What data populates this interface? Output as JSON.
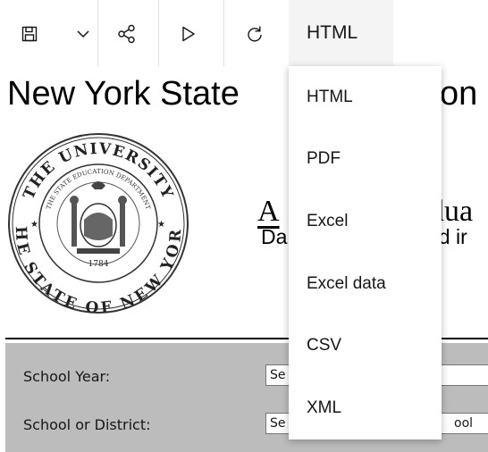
{
  "toolbar": {
    "icons": [
      "save-icon",
      "chevron-down-icon",
      "share-icon",
      "run-icon",
      "refresh-icon"
    ],
    "format_label": "HTML"
  },
  "report": {
    "title": "New York State",
    "title_tail": "on",
    "subtitle_head": "A",
    "subtitle_tail": "dua",
    "subline_head": "Da",
    "subline_tail": "ed ir",
    "seal": {
      "top_text": "THE UNIVERSITY",
      "inner_text": "THE STATE EDUCATION DEPARTMENT",
      "bottom_text": "THE STATE OF NEW YORK",
      "year": "1784"
    }
  },
  "prompts": {
    "school_year_label": "School Year:",
    "school_year_value": "Se",
    "school_label": "School or District:",
    "school_value_head": "Se",
    "school_value_tail": "ool"
  },
  "menu": {
    "items": [
      "HTML",
      "PDF",
      "Excel",
      "Excel data",
      "CSV",
      "XML"
    ]
  }
}
